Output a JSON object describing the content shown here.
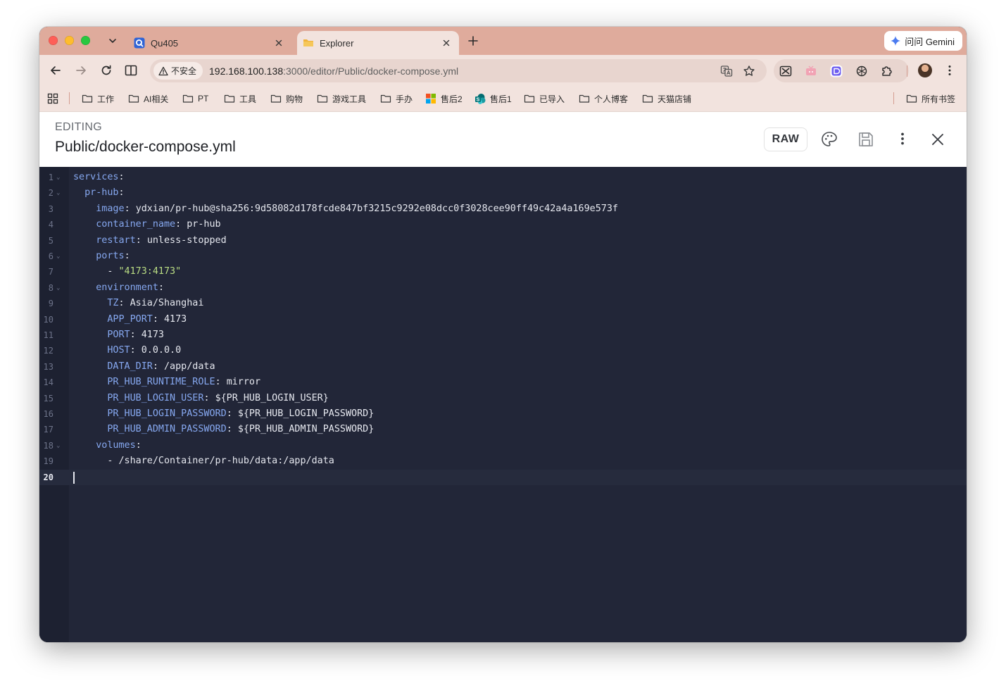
{
  "browser": {
    "tabs": [
      {
        "label": "Qu405",
        "active": false
      },
      {
        "label": "Explorer",
        "active": true
      }
    ],
    "gemini_label": "问问 Gemini",
    "omnibox": {
      "security_label": "不安全",
      "url_host": "192.168.100.138",
      "url_rest": ":3000/editor/Public/docker-compose.yml"
    },
    "bookmarks": [
      {
        "label": "工作",
        "icon": "folder-icon"
      },
      {
        "label": "AI相关",
        "icon": "folder-icon"
      },
      {
        "label": "PT",
        "icon": "folder-icon"
      },
      {
        "label": "工具",
        "icon": "folder-icon"
      },
      {
        "label": "购物",
        "icon": "folder-icon"
      },
      {
        "label": "游戏工具",
        "icon": "folder-icon"
      },
      {
        "label": "手办",
        "icon": "folder-icon"
      },
      {
        "label": "售后2",
        "icon": "microsoft-icon"
      },
      {
        "label": "售后1",
        "icon": "sharepoint-icon"
      },
      {
        "label": "已导入",
        "icon": "folder-icon"
      },
      {
        "label": "个人博客",
        "icon": "folder-icon"
      },
      {
        "label": "天猫店铺",
        "icon": "folder-icon"
      }
    ],
    "all_bookmarks_label": "所有书签"
  },
  "header": {
    "mode_label": "EDITING",
    "file_path": "Public/docker-compose.yml",
    "raw_button": "RAW"
  },
  "editor": {
    "active_line": 20,
    "lines": [
      {
        "n": "1",
        "fold": true,
        "indent": "",
        "key": "services",
        "sep": ":",
        "value": "",
        "type": "plain"
      },
      {
        "n": "2",
        "fold": true,
        "indent": "  ",
        "key": "pr-hub",
        "sep": ":",
        "value": "",
        "type": "plain"
      },
      {
        "n": "3",
        "fold": false,
        "indent": "    ",
        "key": "image",
        "sep": ": ",
        "value": "ydxian/pr-hub@sha256:9d58082d178fcde847bf3215c9292e08dcc0f3028cee90ff49c42a4a169e573f",
        "type": "plain"
      },
      {
        "n": "4",
        "fold": false,
        "indent": "    ",
        "key": "container_name",
        "sep": ": ",
        "value": "pr-hub",
        "type": "plain"
      },
      {
        "n": "5",
        "fold": false,
        "indent": "    ",
        "key": "restart",
        "sep": ": ",
        "value": "unless-stopped",
        "type": "plain"
      },
      {
        "n": "6",
        "fold": true,
        "indent": "    ",
        "key": "ports",
        "sep": ":",
        "value": "",
        "type": "plain"
      },
      {
        "n": "7",
        "fold": false,
        "indent": "      ",
        "key": "",
        "sep": "- ",
        "value": "\"4173:4173\"",
        "type": "string"
      },
      {
        "n": "8",
        "fold": true,
        "indent": "    ",
        "key": "environment",
        "sep": ":",
        "value": "",
        "type": "plain"
      },
      {
        "n": "9",
        "fold": false,
        "indent": "      ",
        "key": "TZ",
        "sep": ": ",
        "value": "Asia/Shanghai",
        "type": "plain"
      },
      {
        "n": "10",
        "fold": false,
        "indent": "      ",
        "key": "APP_PORT",
        "sep": ": ",
        "value": "4173",
        "type": "plain"
      },
      {
        "n": "11",
        "fold": false,
        "indent": "      ",
        "key": "PORT",
        "sep": ": ",
        "value": "4173",
        "type": "plain"
      },
      {
        "n": "12",
        "fold": false,
        "indent": "      ",
        "key": "HOST",
        "sep": ": ",
        "value": "0.0.0.0",
        "type": "plain"
      },
      {
        "n": "13",
        "fold": false,
        "indent": "      ",
        "key": "DATA_DIR",
        "sep": ": ",
        "value": "/app/data",
        "type": "plain"
      },
      {
        "n": "14",
        "fold": false,
        "indent": "      ",
        "key": "PR_HUB_RUNTIME_ROLE",
        "sep": ": ",
        "value": "mirror",
        "type": "plain"
      },
      {
        "n": "15",
        "fold": false,
        "indent": "      ",
        "key": "PR_HUB_LOGIN_USER",
        "sep": ": ",
        "value": "${PR_HUB_LOGIN_USER}",
        "type": "plain"
      },
      {
        "n": "16",
        "fold": false,
        "indent": "      ",
        "key": "PR_HUB_LOGIN_PASSWORD",
        "sep": ": ",
        "value": "${PR_HUB_LOGIN_PASSWORD}",
        "type": "plain"
      },
      {
        "n": "17",
        "fold": false,
        "indent": "      ",
        "key": "PR_HUB_ADMIN_PASSWORD",
        "sep": ": ",
        "value": "${PR_HUB_ADMIN_PASSWORD}",
        "type": "plain"
      },
      {
        "n": "18",
        "fold": true,
        "indent": "    ",
        "key": "volumes",
        "sep": ":",
        "value": "",
        "type": "plain"
      },
      {
        "n": "19",
        "fold": false,
        "indent": "      ",
        "key": "",
        "sep": "- ",
        "value": "/share/Container/pr-hub/data:/app/data",
        "type": "plain"
      },
      {
        "n": "20",
        "fold": false,
        "indent": "",
        "key": "",
        "sep": "",
        "value": "",
        "type": "plain"
      }
    ]
  },
  "colors": {
    "editor_bg": "#222638",
    "yaml_key": "#86a8f0",
    "yaml_string": "#b9dc83",
    "tabstrip": "#dfab9c"
  }
}
